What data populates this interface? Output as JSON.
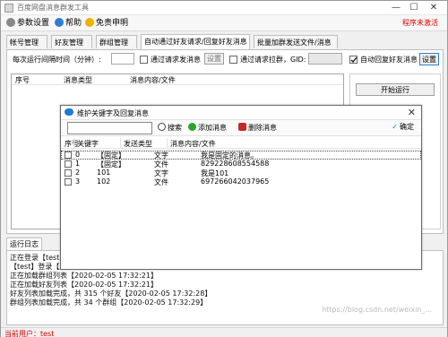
{
  "window": {
    "title": "百度网盘消息群发工具",
    "controls": {
      "min": "—",
      "max": "☐",
      "close": "✕"
    }
  },
  "menubar": {
    "items": [
      {
        "label": "参数设置",
        "icon": "gear-icon"
      },
      {
        "label": "帮助",
        "icon": "help-icon"
      },
      {
        "label": "免责申明",
        "icon": "warning-icon"
      }
    ],
    "warning_text": "程序未激活"
  },
  "tabs": [
    {
      "label": "帐号管理",
      "active": false
    },
    {
      "label": "好友管理",
      "active": false
    },
    {
      "label": "群组管理",
      "active": false
    },
    {
      "label": "自动通过好友请求/回复好友消息",
      "active": true
    },
    {
      "label": "批量加群发送文件/消息",
      "active": false
    }
  ],
  "settings": {
    "interval_label": "每次运行间隔时间（分钟）:",
    "cb_send_msg_label": "通过请求发消息",
    "setup_btn": "设置",
    "cb_pull_group_label": "通过请求拉群，GID:",
    "cb_auto_reply_label": "自动回复好友消息",
    "setup_btn2": "设置"
  },
  "main_list": {
    "headers": [
      "序号",
      "消息类型",
      "消息内容/文件"
    ]
  },
  "side_panel": {
    "start_btn": "开始运行"
  },
  "dialog": {
    "title": "维护关键字及回复消息",
    "toolbar": {
      "search_btn": "搜索",
      "add_btn": "添加消息",
      "delete_btn": "删除消息",
      "ok_btn": "确定"
    },
    "headers": [
      "序号",
      "关键字",
      "发送类型",
      "消息内容/文件"
    ],
    "rows": [
      {
        "idx": "0",
        "keyword": "【固定】",
        "type": "文字",
        "content": "我是固定的消息。",
        "selected": true
      },
      {
        "idx": "1",
        "keyword": "【固定】",
        "type": "文件",
        "content": "829228608554588",
        "selected": false
      },
      {
        "idx": "2",
        "keyword": "101",
        "type": "文字",
        "content": "我是101",
        "selected": false
      },
      {
        "idx": "3",
        "keyword": "102",
        "type": "文件",
        "content": "697266042037965",
        "selected": false
      }
    ]
  },
  "log": {
    "tab_label": "运行日志",
    "lines": [
      "正在登录【test】...",
      "【test】登录【成功】【2020-02-05 17:32:21】",
      "正在加载群组列表【2020-02-05 17:32:21】",
      "正在加载好友列表【2020-02-05 17:32:21】",
      "好友列表加载完成，共 315 个好友【2020-02-05 17:32:28】",
      "群组列表加载完成，共 34 个群组【2020-02-05 17:32:29】"
    ]
  },
  "status": {
    "text": "当前用户：test"
  },
  "watermark": "https://blog.csdn.net/weixin_..."
}
